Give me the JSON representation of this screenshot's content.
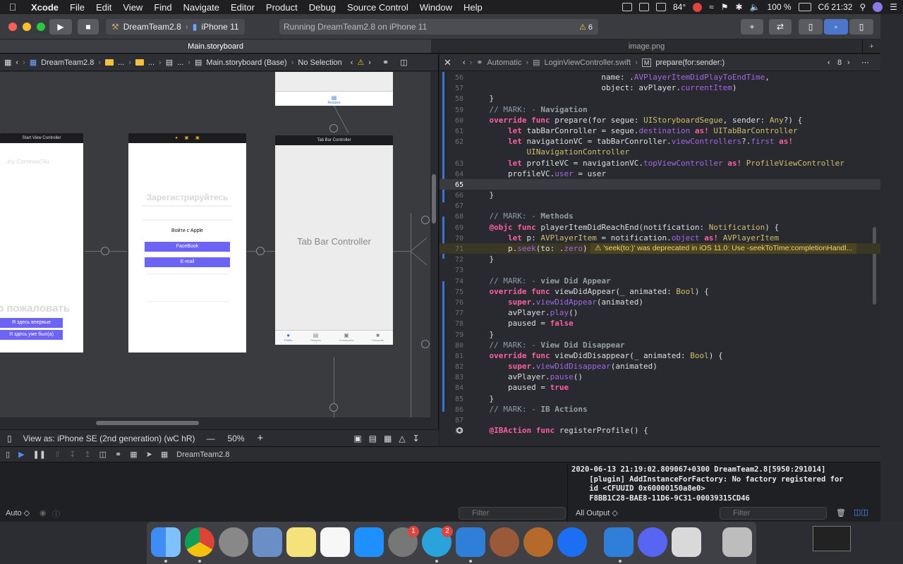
{
  "menubar": {
    "app": "Xcode",
    "items": [
      "File",
      "Edit",
      "View",
      "Find",
      "Navigate",
      "Editor",
      "Product",
      "Debug",
      "Source Control",
      "Window",
      "Help"
    ],
    "weather": "84°",
    "battery": "100 %",
    "clock": "Сб 21:32"
  },
  "toolbar": {
    "scheme": "DreamTeam2.8",
    "device": "iPhone 11",
    "status": "Running DreamTeam2.8 on iPhone 11",
    "warnings": "6"
  },
  "tabs": [
    "Main.storyboard",
    "image.png"
  ],
  "left_jumpbar": {
    "project": "DreamTeam2.8",
    "file": "Main.storyboard (Base)",
    "selection": "No Selection",
    "ellipsis": "..."
  },
  "storyboard": {
    "start_vc_title": "Start View Controller",
    "start_vc_heading_faint": "...thy Common(Te)",
    "welcome": "о пожаловать",
    "first_time": "Я здесь впервые",
    "been_here": "Я здесь уже был(а)",
    "register_title": "Зарегистрируйтесь",
    "apple_signin": "Войти с  Apple",
    "facebook": "FaceBook",
    "email": "E-mail",
    "tab_bar_title": "Tab Bar Controller",
    "tab_bar_label": "Tab Bar Controller",
    "top_tab_item": "Recipes",
    "tab_items": [
      "Profile",
      "Recipes",
      "Constructor",
      "Favourite"
    ]
  },
  "left_bottom": {
    "view_as": "View as: iPhone SE (2nd generation) (wC hR)",
    "zoom": "50%"
  },
  "right_jumpbar": {
    "mode": "Automatic",
    "file": "LoginViewController.swift",
    "method": "prepare(for:sender:)",
    "count": "8"
  },
  "code_lines": [
    {
      "n": "56",
      "t": "                            name: .AVPlayerItemDidPlayToEndTime,"
    },
    {
      "n": "57",
      "t": "                            object: avPlayer.currentItem)"
    },
    {
      "n": "58",
      "t": "    }"
    },
    {
      "n": "59",
      "t": "    // MARK: - Navigation"
    },
    {
      "n": "60",
      "t": "    override func prepare(for segue: UIStoryboardSegue, sender: Any?) {"
    },
    {
      "n": "61",
      "t": "        let tabBarConroller = segue.destination as! UITabBarController"
    },
    {
      "n": "62",
      "t": "        let navigationVC = tabBarConroller.viewControllers?.first as!"
    },
    {
      "n": "",
      "t": "            UINavigationController"
    },
    {
      "n": "63",
      "t": "        let profileVC = navigationVC.topViewController as! ProfileViewController"
    },
    {
      "n": "64",
      "t": "        profileVC.user = user"
    },
    {
      "n": "65",
      "t": ""
    },
    {
      "n": "66",
      "t": "    }"
    },
    {
      "n": "67",
      "t": ""
    },
    {
      "n": "68",
      "t": "    // MARK: - Methods"
    },
    {
      "n": "69",
      "t": "    @objc func playerItemDidReachEnd(notification: Notification) {"
    },
    {
      "n": "70",
      "t": "        let p: AVPlayerItem = notification.object as! AVPlayerItem"
    },
    {
      "n": "71",
      "t": "        p.seek(to: .zero)"
    },
    {
      "n": "72",
      "t": "    }"
    },
    {
      "n": "73",
      "t": ""
    },
    {
      "n": "74",
      "t": "    // MARK: - view Did Appear"
    },
    {
      "n": "75",
      "t": "    override func viewDidAppear(_ animated: Bool) {"
    },
    {
      "n": "76",
      "t": "        super.viewDidAppear(animated)"
    },
    {
      "n": "77",
      "t": "        avPlayer.play()"
    },
    {
      "n": "78",
      "t": "        paused = false"
    },
    {
      "n": "79",
      "t": "    }"
    },
    {
      "n": "80",
      "t": "    // MARK: - View Did Disappear"
    },
    {
      "n": "81",
      "t": "    override func viewDidDisappear(_ animated: Bool) {"
    },
    {
      "n": "82",
      "t": "        super.viewDidDisappear(animated)"
    },
    {
      "n": "83",
      "t": "        avPlayer.pause()"
    },
    {
      "n": "84",
      "t": "        paused = true"
    },
    {
      "n": "85",
      "t": "    }"
    },
    {
      "n": "86",
      "t": "    // MARK: - IB Actions"
    },
    {
      "n": "87",
      "t": ""
    },
    {
      "n": "88",
      "t": "    @IBAction func registerProfile() {"
    }
  ],
  "warning_message": "'seek(to:)' was deprecated in iOS 11.0: Use -seekToTime:completionHandl...",
  "debug": {
    "target": "DreamTeam2.8",
    "console": "2020-06-13 21:19:02.809067+0300 DreamTeam2.8[5950:291014]\n    [plugin] AddInstanceForFactory: No factory registered for\n    id <CFUUID 0x60000150a8e0>\n    F8BB1C28-BAE8-11D6-9C31-00039315CD46",
    "auto": "Auto ◇",
    "filter_placeholder": "Filter",
    "all_output": "All Output ◇"
  },
  "dock": {
    "badges": {
      "system_prefs": "1",
      "telegram": "2"
    }
  }
}
